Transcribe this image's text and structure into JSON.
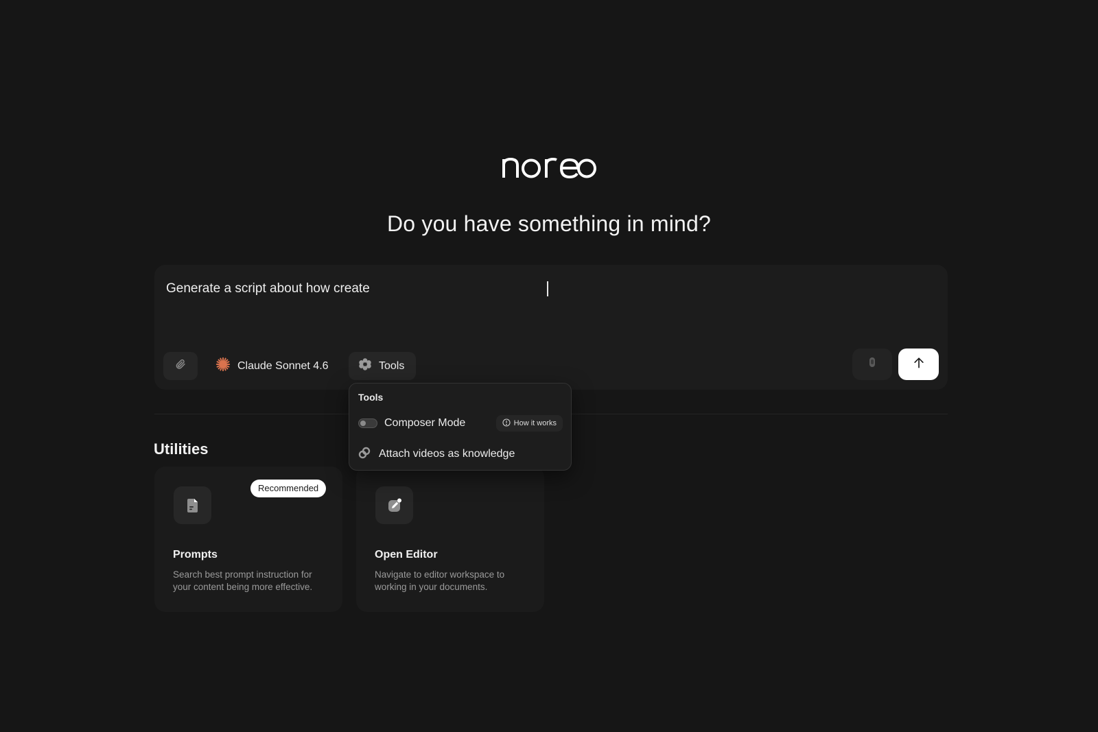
{
  "logo": {
    "text": "noreo"
  },
  "headline": "Do you have something in mind?",
  "composer": {
    "prompt_value": "Generate a script about how create",
    "model_label": "Claude Sonnet 4.6",
    "tools_label": "Tools",
    "icons": {
      "attach": "paperclip-icon",
      "model": "claude-asterisk-icon",
      "tools": "gear-icon",
      "mic": "microphone-icon",
      "send": "arrow-up-icon"
    },
    "model_icon_color": "#d9734e"
  },
  "tools_dropdown": {
    "title": "Tools",
    "composer_mode_label": "Composer Mode",
    "composer_mode_enabled": false,
    "how_it_works_label": "How it works",
    "attach_videos_label": "Attach videos as knowledge"
  },
  "utilities": {
    "title": "Utilities",
    "cards": [
      {
        "title": "Prompts",
        "description": "Search best prompt instruction for your content being more effective.",
        "badge": "Recommended",
        "icon": "document-icon"
      },
      {
        "title": "Open Editor",
        "description": "Navigate to editor workspace to working in your documents.",
        "icon": "edit-icon"
      }
    ]
  },
  "colors": {
    "background": "#161616",
    "surface": "#1c1c1c",
    "send_button": "#ffffff"
  }
}
